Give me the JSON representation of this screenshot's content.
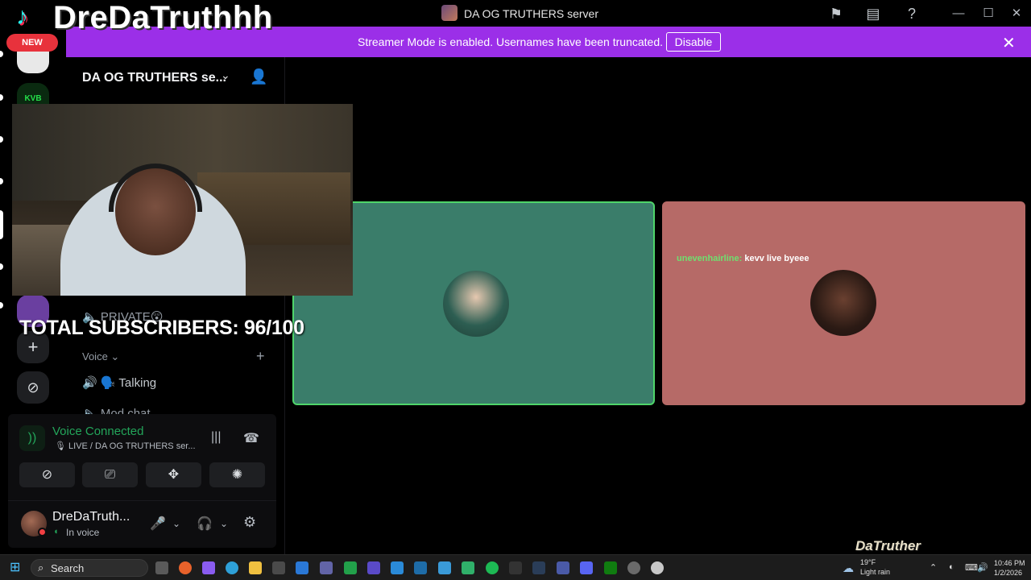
{
  "titlebar": {
    "title": "DA OG TRUTHERS server",
    "icons": [
      "flag-icon",
      "inbox-icon",
      "help-icon"
    ],
    "window_controls": [
      "minimize-icon",
      "maximize-icon",
      "close-icon"
    ]
  },
  "streamer_bar": {
    "message": "Streamer Mode is enabled. Usernames have been truncated.",
    "disable_label": "Disable",
    "color": "#9b2fe8"
  },
  "overlay": {
    "tiktok_name": "DreDaTruthhh",
    "new_badge": "NEW",
    "subscribers": "TOTAL SUBSCRIBERS: 96/100",
    "watermark": "DaTruther"
  },
  "rail": {
    "label_kvb": "KVB"
  },
  "sidebar": {
    "server_name": "DA OG TRUTHERS se...",
    "channels": [
      {
        "label": "PRIVATE😲",
        "icon": "speaker-icon"
      },
      {
        "label": "🗣️ Talking",
        "icon": "speaker-icon"
      },
      {
        "label": "Mod chat",
        "icon": "speaker-icon"
      }
    ],
    "voice_category": "Voice ⌄"
  },
  "voice_panel": {
    "title": "Voice Connected",
    "subtitle": "LIVE / DA OG TRUTHERS ser...",
    "buttons": [
      "camera-off-icon",
      "screen-share-icon",
      "activities-icon",
      "soundboard-icon"
    ]
  },
  "user": {
    "name": "DreDaTruth...",
    "status": "In voice"
  },
  "stage": {
    "tile_1_color": "#3a7d6a",
    "tile_2_color": "#b66a67",
    "chat_user": "unevenhairline:",
    "chat_message": " kevv live byeee"
  },
  "taskbar": {
    "search_label": "Search",
    "weather_temp": "19°F",
    "weather_desc": "Light rain",
    "time": "10:46 PM",
    "date": "1/2/2026"
  }
}
